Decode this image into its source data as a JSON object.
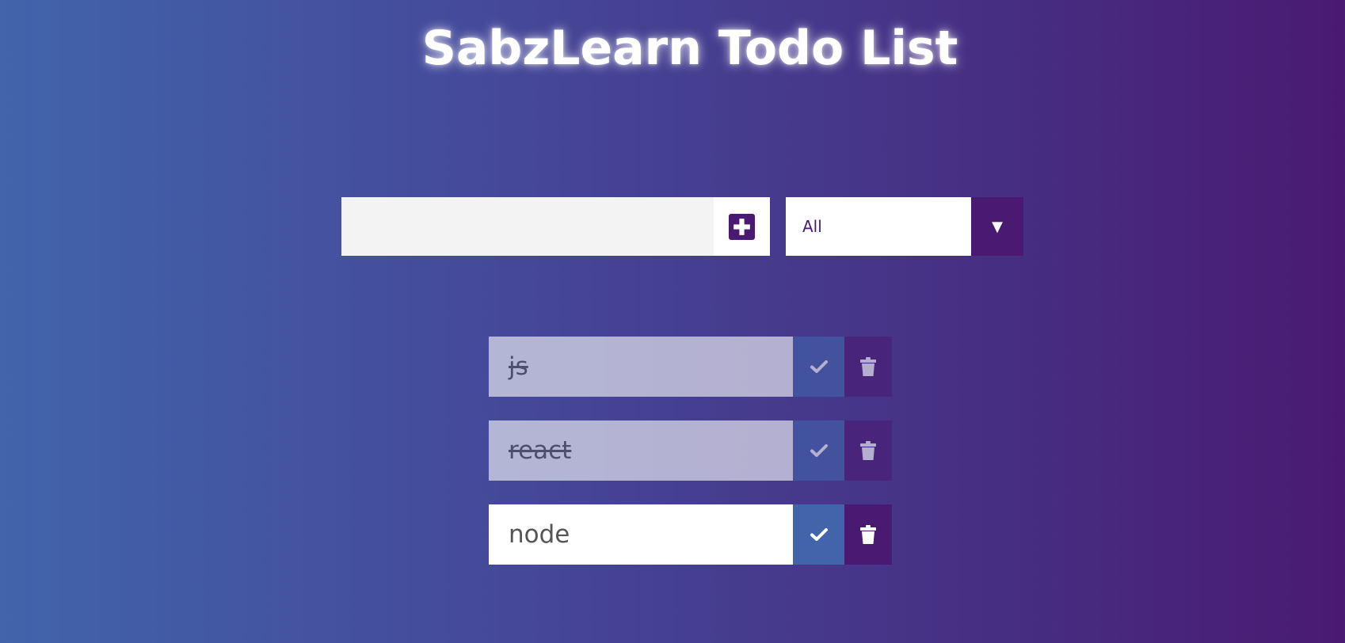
{
  "title": "SabzLearn Todo List",
  "add_form": {
    "input_value": "",
    "add_icon": "plus-square-icon"
  },
  "filter": {
    "selected": "All",
    "arrow_icon": "caret-down-icon",
    "arrow_glyph": "▼"
  },
  "todos": [
    {
      "text": "js",
      "completed": true
    },
    {
      "text": "react",
      "completed": true
    },
    {
      "text": "node",
      "completed": false
    }
  ],
  "colors": {
    "gradient_start": "#4164ab",
    "gradient_end": "#4a1a72",
    "check_button": "#4164ab",
    "trash_button": "#4a1a72",
    "accent": "#4a1a72"
  },
  "icons": {
    "check": "check-icon",
    "trash": "trash-icon"
  }
}
